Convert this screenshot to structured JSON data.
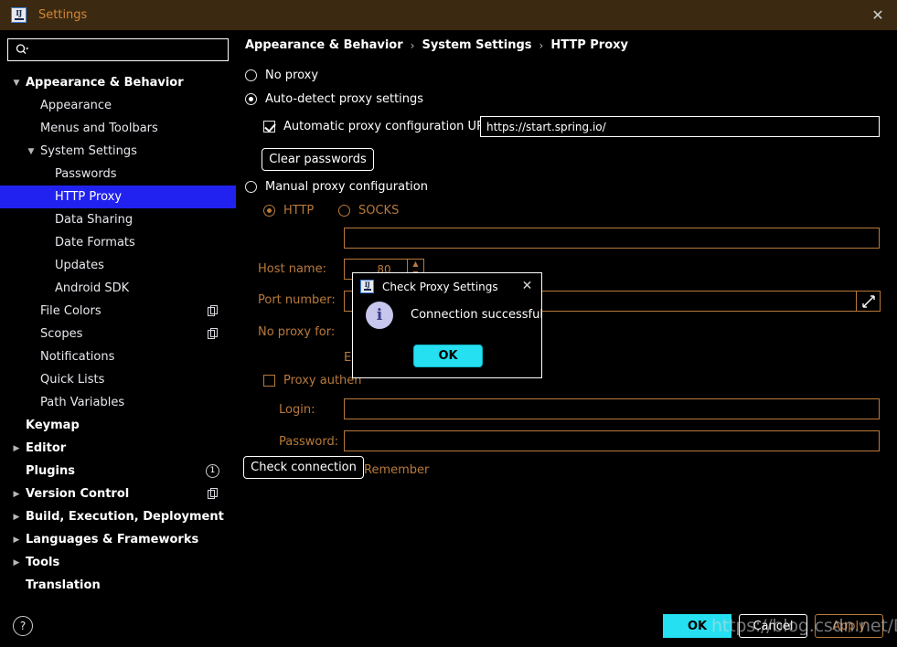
{
  "window": {
    "title": "Settings",
    "logo_text": "IJ",
    "close_label": "✕"
  },
  "search": {
    "value": "",
    "placeholder": "",
    "icon": "search-icon"
  },
  "sidebar": {
    "items": [
      {
        "label": "Appearance & Behavior",
        "level": 0,
        "bold": true,
        "twisty": "▼",
        "selected": false,
        "badge": null,
        "copy": false
      },
      {
        "label": "Appearance",
        "level": 1,
        "bold": false,
        "twisty": "",
        "selected": false,
        "badge": null,
        "copy": false
      },
      {
        "label": "Menus and Toolbars",
        "level": 1,
        "bold": false,
        "twisty": "",
        "selected": false,
        "badge": null,
        "copy": false
      },
      {
        "label": "System Settings",
        "level": 1,
        "bold": false,
        "twisty": "▼",
        "selected": false,
        "badge": null,
        "copy": false
      },
      {
        "label": "Passwords",
        "level": 2,
        "bold": false,
        "twisty": "",
        "selected": false,
        "badge": null,
        "copy": false
      },
      {
        "label": "HTTP Proxy",
        "level": 2,
        "bold": false,
        "twisty": "",
        "selected": true,
        "badge": null,
        "copy": false
      },
      {
        "label": "Data Sharing",
        "level": 2,
        "bold": false,
        "twisty": "",
        "selected": false,
        "badge": null,
        "copy": false
      },
      {
        "label": "Date Formats",
        "level": 2,
        "bold": false,
        "twisty": "",
        "selected": false,
        "badge": null,
        "copy": false
      },
      {
        "label": "Updates",
        "level": 2,
        "bold": false,
        "twisty": "",
        "selected": false,
        "badge": null,
        "copy": false
      },
      {
        "label": "Android SDK",
        "level": 2,
        "bold": false,
        "twisty": "",
        "selected": false,
        "badge": null,
        "copy": false
      },
      {
        "label": "File Colors",
        "level": 1,
        "bold": false,
        "twisty": "",
        "selected": false,
        "badge": null,
        "copy": true
      },
      {
        "label": "Scopes",
        "level": 1,
        "bold": false,
        "twisty": "",
        "selected": false,
        "badge": null,
        "copy": true
      },
      {
        "label": "Notifications",
        "level": 1,
        "bold": false,
        "twisty": "",
        "selected": false,
        "badge": null,
        "copy": false
      },
      {
        "label": "Quick Lists",
        "level": 1,
        "bold": false,
        "twisty": "",
        "selected": false,
        "badge": null,
        "copy": false
      },
      {
        "label": "Path Variables",
        "level": 1,
        "bold": false,
        "twisty": "",
        "selected": false,
        "badge": null,
        "copy": false
      },
      {
        "label": "Keymap",
        "level": 0,
        "bold": true,
        "twisty": "",
        "selected": false,
        "badge": null,
        "copy": false
      },
      {
        "label": "Editor",
        "level": 0,
        "bold": true,
        "twisty": "▶",
        "selected": false,
        "badge": null,
        "copy": false
      },
      {
        "label": "Plugins",
        "level": 0,
        "bold": true,
        "twisty": "",
        "selected": false,
        "badge": "1",
        "copy": false
      },
      {
        "label": "Version Control",
        "level": 0,
        "bold": true,
        "twisty": "▶",
        "selected": false,
        "badge": null,
        "copy": true
      },
      {
        "label": "Build, Execution, Deployment",
        "level": 0,
        "bold": true,
        "twisty": "▶",
        "selected": false,
        "badge": null,
        "copy": false
      },
      {
        "label": "Languages & Frameworks",
        "level": 0,
        "bold": true,
        "twisty": "▶",
        "selected": false,
        "badge": null,
        "copy": false
      },
      {
        "label": "Tools",
        "level": 0,
        "bold": true,
        "twisty": "▶",
        "selected": false,
        "badge": null,
        "copy": false
      },
      {
        "label": "Translation",
        "level": 0,
        "bold": true,
        "twisty": "",
        "selected": false,
        "badge": null,
        "copy": false
      }
    ]
  },
  "breadcrumb": {
    "part1": "Appearance & Behavior",
    "sep1": "›",
    "part2": "System Settings",
    "sep2": "›",
    "part3": "HTTP Proxy"
  },
  "proxy": {
    "no_proxy_label": "No proxy",
    "auto_detect_label": "Auto-detect proxy settings",
    "auto_config_url_label": "Automatic proxy configuration URL:",
    "auto_config_url_value": "https://start.spring.io/",
    "clear_passwords_label": "Clear passwords",
    "manual_label": "Manual proxy configuration",
    "http_label": "HTTP",
    "socks_label": "SOCKS",
    "host_name_label": "Host name:",
    "host_name_value": "",
    "port_number_label": "Port number:",
    "port_number_value": "80",
    "no_proxy_for_label": "No proxy for:",
    "no_proxy_for_value": "",
    "example_hint": "Ex",
    "proxy_auth_label": "Proxy authen",
    "login_label": "Login:",
    "login_value": "",
    "password_label": "Password:",
    "password_value": "",
    "remember_label": "Remember",
    "check_connection_label": "Check connection",
    "expand_icon": "expand-icon",
    "spin_up": "▲",
    "spin_down": "▼"
  },
  "dialog": {
    "logo_text": "IJ",
    "title": "Check Proxy Settings",
    "close_label": "✕",
    "icon": "info-icon",
    "icon_glyph": "i",
    "message": "Connection successful",
    "ok_label": "OK"
  },
  "footer": {
    "help_label": "?",
    "ok_label": "OK",
    "cancel_label": "Cancel",
    "apply_label": "Apply",
    "watermark": "https://blog.csdn.net/Deroser"
  },
  "colors": {
    "titlebar_bg": "#3b2a11",
    "titlebar_text": "#d58634",
    "selection_blue": "#2222f0",
    "disabled_orange": "#b8793c",
    "accent_cyan": "#25e0f0",
    "info_lavender": "#c7c6ec"
  }
}
